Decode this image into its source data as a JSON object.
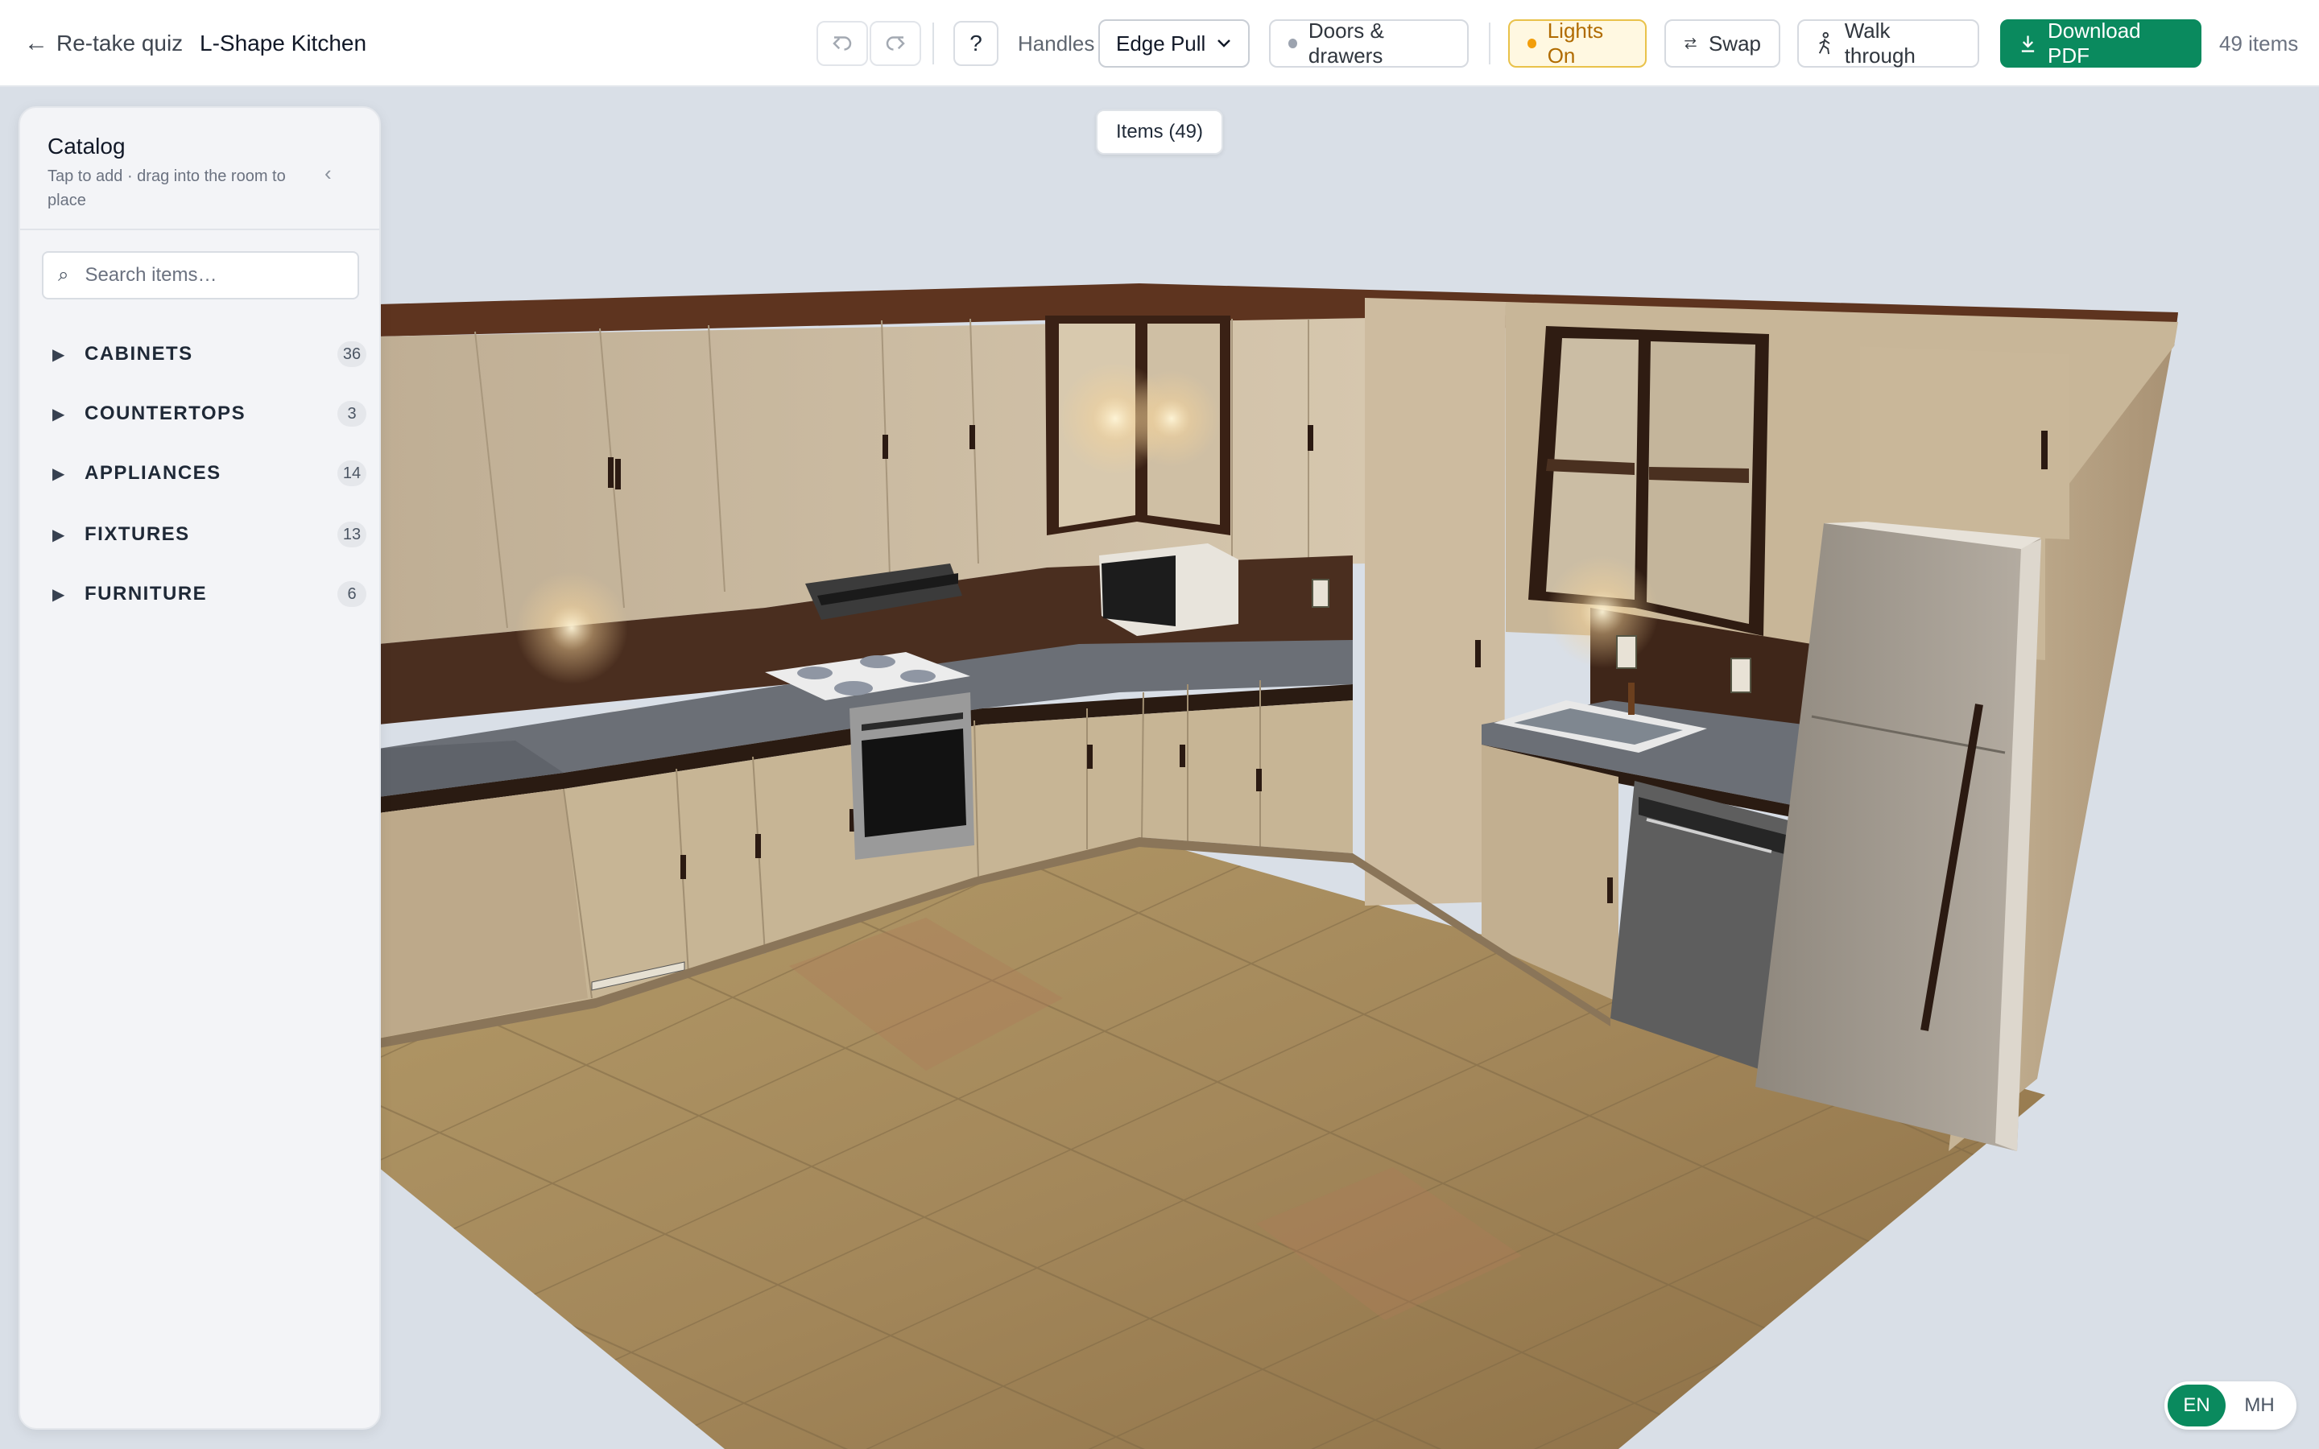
{
  "header": {
    "back_label": "Re-take quiz",
    "back_arrow": "←",
    "room_title": "L-Shape Kitchen",
    "undo_icon": "undo-icon",
    "redo_icon": "redo-icon",
    "help_label": "?",
    "handles_label": "Handles",
    "handles_value": "Edge Pull",
    "doors_label": "Doors & drawers",
    "lights_label": "Lights On",
    "swap_label": "Swap",
    "walk_label": "Walk through",
    "download_label": "Download PDF",
    "items_count": "49 items"
  },
  "scene": {
    "items_chip": "Items (49)"
  },
  "catalog": {
    "title": "Catalog",
    "subtitle": "Tap to add · drag into the room to place",
    "collapse_icon": "‹",
    "search_placeholder": "Search items…",
    "categories": [
      {
        "name": "CABINETS",
        "count": "36"
      },
      {
        "name": "COUNTERTOPS",
        "count": "3"
      },
      {
        "name": "APPLIANCES",
        "count": "14"
      },
      {
        "name": "FIXTURES",
        "count": "13"
      },
      {
        "name": "FURNITURE",
        "count": "6"
      }
    ]
  },
  "language": {
    "en": "EN",
    "mh": "MH",
    "active": "EN"
  },
  "colors": {
    "accent": "#0a8a5e",
    "lights_bg": "#fff8e1",
    "lights_border": "#e9c24a",
    "cabinet": "#c9b69a",
    "floor": "#a4865a",
    "backsplash": "#4a2e1f"
  }
}
